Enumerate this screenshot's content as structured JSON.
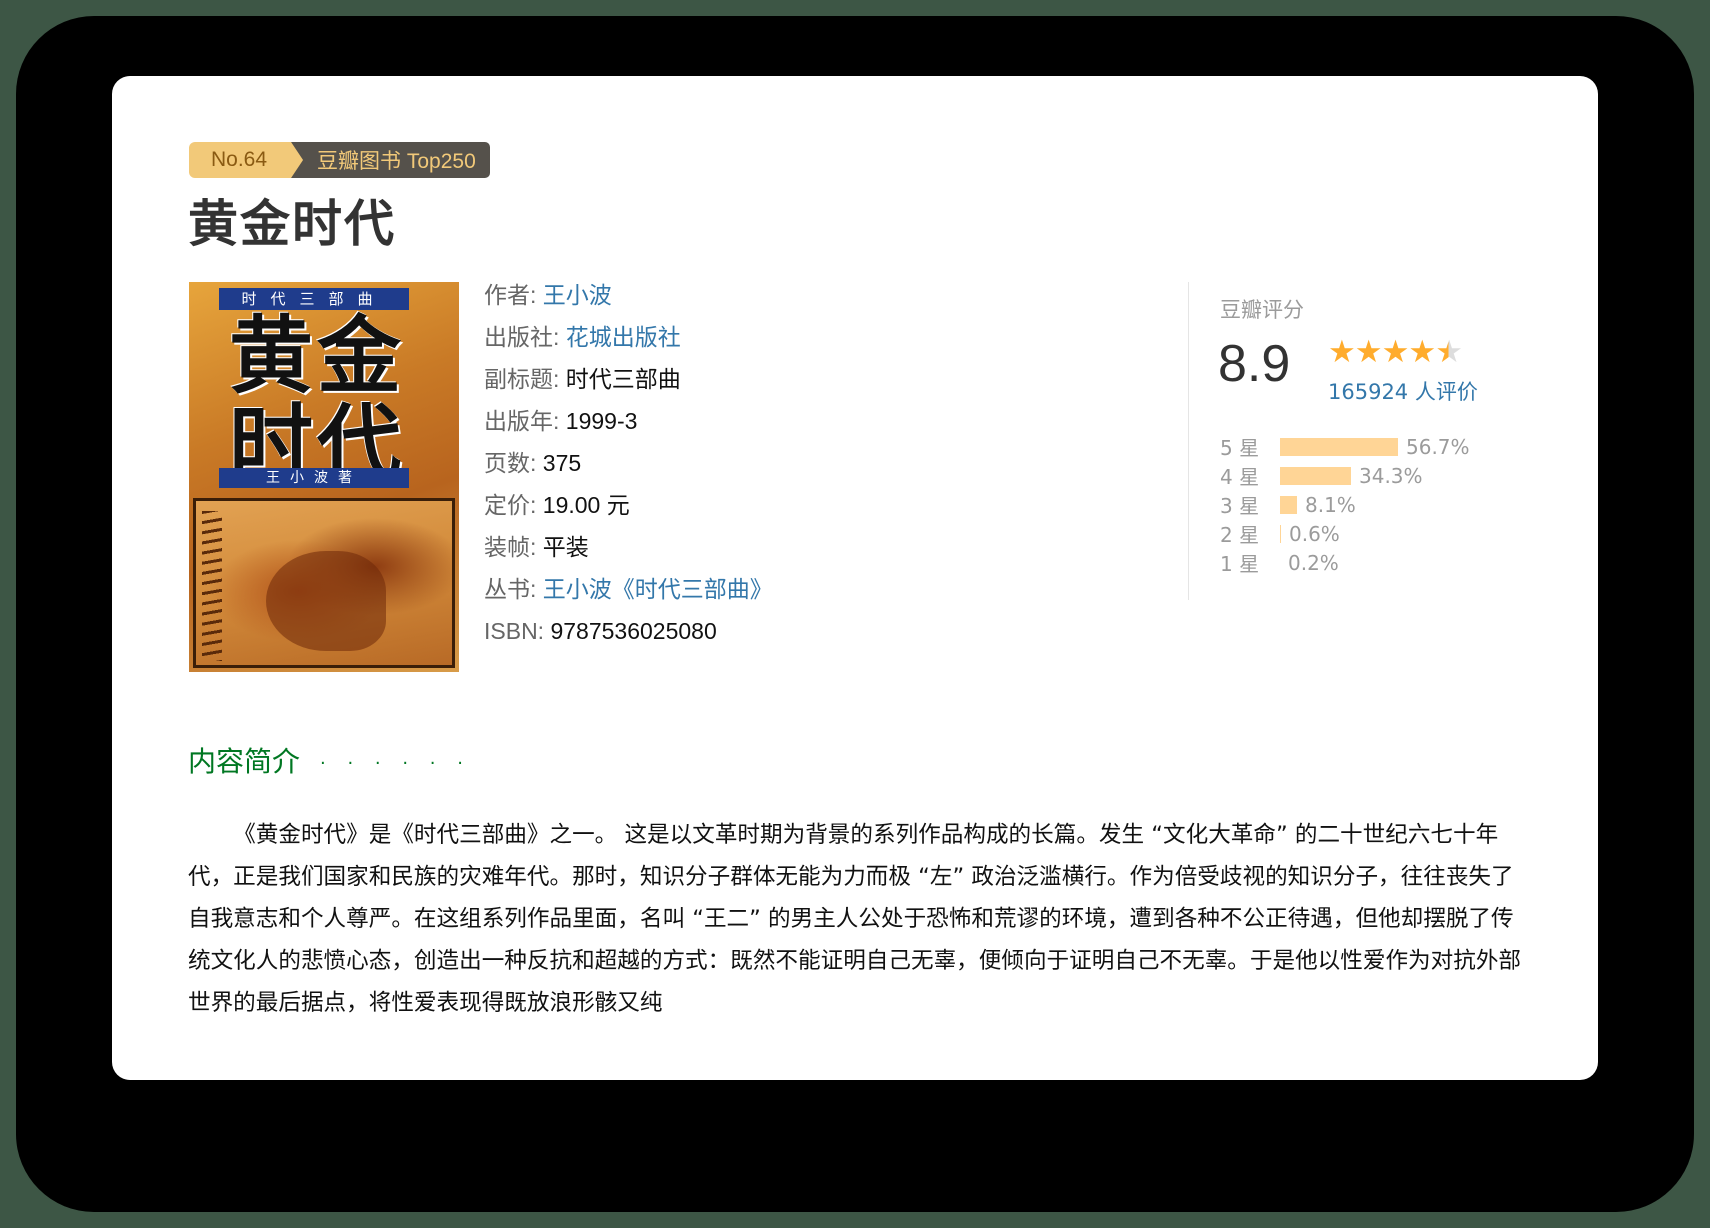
{
  "badge": {
    "rank": "No.64",
    "list": "豆瓣图书 Top250"
  },
  "book": {
    "title": "黄金时代",
    "cover": {
      "series_text": "时代三部曲",
      "title_line1": "黄金",
      "title_line2": "时代",
      "author_text": "王小波著"
    },
    "info": {
      "author_label": "作者:",
      "author": "王小波",
      "publisher_label": "出版社:",
      "publisher": "花城出版社",
      "subtitle_label": "副标题:",
      "subtitle": "时代三部曲",
      "year_label": "出版年:",
      "year": "1999-3",
      "pages_label": "页数:",
      "pages": "375",
      "price_label": "定价:",
      "price": "19.00 元",
      "binding_label": "装帧:",
      "binding": "平装",
      "series_label": "丛书:",
      "series": "王小波《时代三部曲》",
      "isbn_label": "ISBN:",
      "isbn": "9787536025080"
    }
  },
  "rating": {
    "label": "豆瓣评分",
    "score": "8.9",
    "stars": 4.5,
    "votes": "165924 人评价",
    "distribution": [
      {
        "label": "5 星",
        "percent": "56.7%",
        "value": 56.7
      },
      {
        "label": "4 星",
        "percent": "34.3%",
        "value": 34.3
      },
      {
        "label": "3 星",
        "percent": "8.1%",
        "value": 8.1
      },
      {
        "label": "2 星",
        "percent": "0.6%",
        "value": 0.6
      },
      {
        "label": "1 星",
        "percent": "0.2%",
        "value": 0.2
      }
    ]
  },
  "intro": {
    "heading": "内容简介",
    "dots": "· · · · · ·",
    "text": "《黄金时代》是《时代三部曲》之一。 这是以文革时期为背景的系列作品构成的长篇。发生 “文化大革命” 的二十世纪六七十年代，正是我们国家和民族的灾难年代。那时，知识分子群体无能为力而极 “左” 政治泛滥横行。作为倍受歧视的知识分子，往往丧失了自我意志和个人尊严。在这组系列作品里面，名叫 “王二” 的男主人公处于恐怖和荒谬的环境，遭到各种不公正待遇，但他却摆脱了传统文化人的悲愤心态，创造出一种反抗和超越的方式：既然不能证明自己无辜，便倾向于证明自己不无辜。于是他以性爱作为对抗外部世界的最后据点，将性爱表现得既放浪形骸又纯"
  },
  "colors": {
    "link": "#3377aa",
    "star": "#ffac2d",
    "bar": "#ffd596",
    "heading_green": "#007722"
  }
}
